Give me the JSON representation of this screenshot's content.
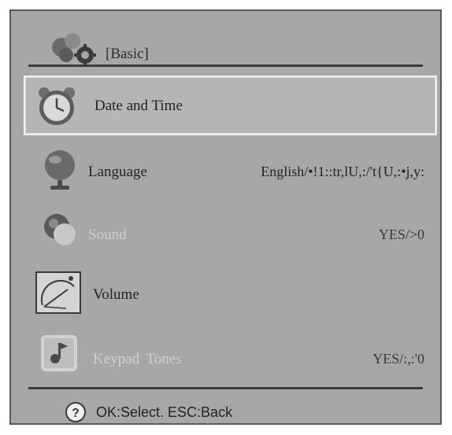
{
  "header": {
    "title": "[Basic]",
    "icon": "gear-cluster-icon"
  },
  "menu": {
    "items": [
      {
        "label": "Date and Time",
        "value": "",
        "icon": "clock-icon",
        "enabled": true,
        "selected": true
      },
      {
        "label": "Language",
        "value": "English/•!1::tr,lU,:/'t{U,:•j,y:",
        "icon": "globe-icon",
        "enabled": true,
        "selected": false
      },
      {
        "label": "Sound",
        "value": "YES/>0",
        "icon": "speaker-icon",
        "enabled": false,
        "selected": false
      },
      {
        "label": "Volume",
        "value": "",
        "icon": "gauge-icon",
        "enabled": true,
        "selected": false
      },
      {
        "label": "Keypad  Tones",
        "value": "YES/:,:'0",
        "icon": "music-note-icon",
        "enabled": false,
        "selected": false
      }
    ]
  },
  "footer": {
    "hint": "OK:Select. ESC:Back",
    "icon": "help-icon"
  },
  "colors": {
    "panel": "#a7a7a7",
    "border": "#5a5a5a",
    "text": "#232323",
    "disabled_text": "#cfcfcf"
  }
}
